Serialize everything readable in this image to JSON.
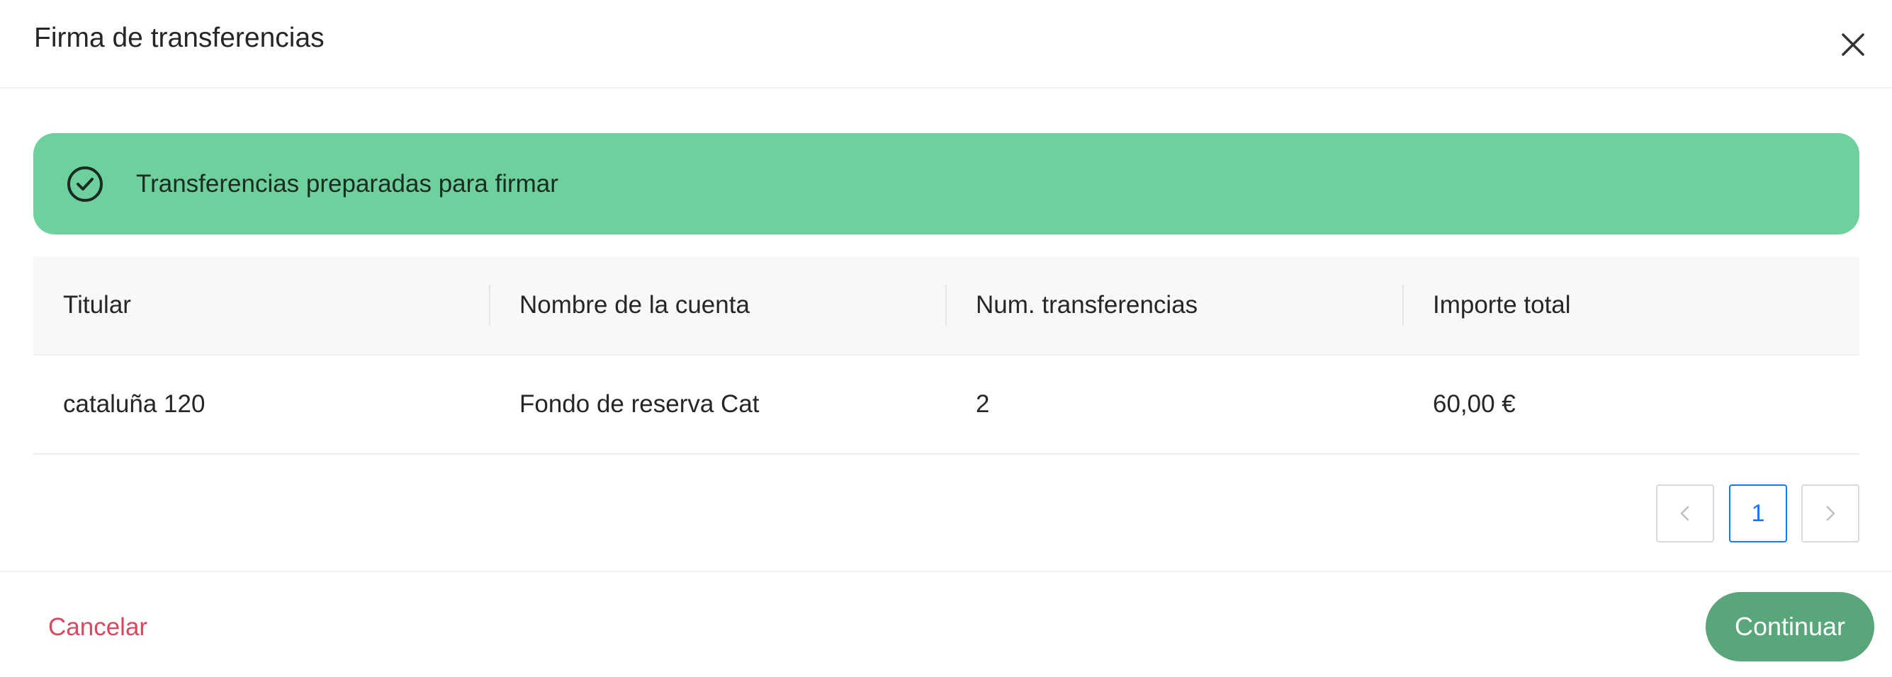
{
  "modal": {
    "title": "Firma de transferencias"
  },
  "alert": {
    "message": "Transferencias preparadas para firmar",
    "icon": "check-circle-icon",
    "color": "#6dd09d"
  },
  "table": {
    "columns": [
      "Titular",
      "Nombre de la cuenta",
      "Num. transferencias",
      "Importe total"
    ],
    "rows": [
      [
        "cataluña 120",
        "Fondo de reserva Cat",
        "2",
        "60,00 €"
      ]
    ]
  },
  "pagination": {
    "current_page": "1",
    "prev_icon": "chevron-left-icon",
    "next_icon": "chevron-right-icon"
  },
  "footer": {
    "cancel_label": "Cancelar",
    "continue_label": "Continuar"
  },
  "colors": {
    "accent": "#5aa67b",
    "danger": "#d9485f",
    "page_active": "#1677ff"
  }
}
